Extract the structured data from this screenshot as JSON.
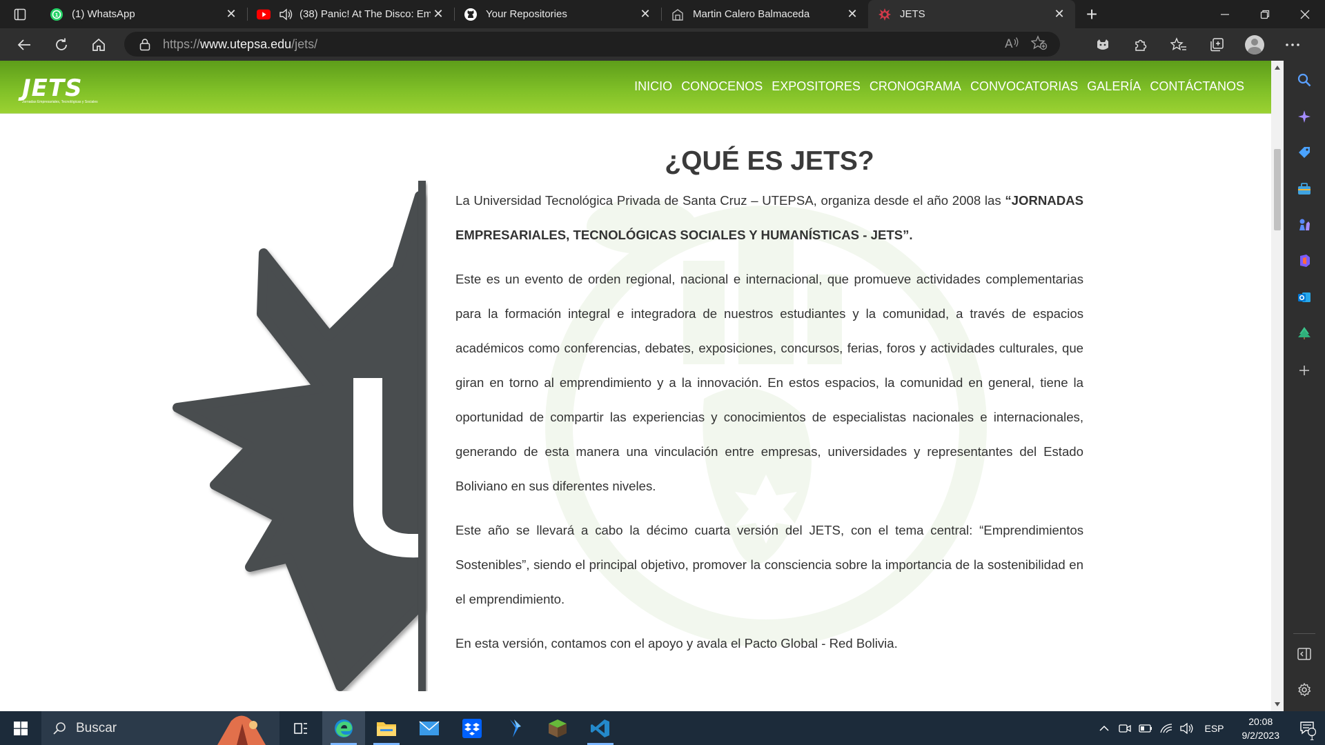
{
  "browser": {
    "tabs": [
      {
        "title": "(1) WhatsApp",
        "icon": "whatsapp-icon",
        "active": false
      },
      {
        "title": "(38) Panic! At The Disco: Em",
        "icon": "youtube-icon",
        "audible": true,
        "active": false
      },
      {
        "title": "Your Repositories",
        "icon": "github-icon",
        "active": false
      },
      {
        "title": "Martin Calero Balmaceda",
        "icon": "page-icon",
        "active": false
      },
      {
        "title": "JETS",
        "icon": "jets-icon",
        "active": true
      }
    ],
    "url": {
      "scheme": "https://",
      "host": "www.utepsa.edu",
      "path": "/jets/"
    }
  },
  "site": {
    "logo": {
      "text": "JETS",
      "subtitle": "Jornadas Empresariales, Tecnológicas y Sociales"
    },
    "nav": [
      "INICIO",
      "CONOCENOS",
      "EXPOSITORES",
      "CRONOGRAMA",
      "CONVOCATORIAS",
      "GALERÍA",
      "CONTÁCTANOS"
    ],
    "heading": "¿QUÉ ES JETS?",
    "intro": "La Universidad Tecnológica Privada de Santa Cruz – UTEPSA, organiza desde el año 2008 las",
    "intro_strong": "“JORNADAS EMPRESARIALES, TECNOLÓGICAS SOCIALES Y HUMANÍSTICAS - JETS”.",
    "paragraphs": [
      "Este es un evento de orden regional, nacional e internacional, que promueve actividades complementarias para la formación integral e integradora de nuestros estudiantes y la comunidad, a través de espacios académicos como conferencias, debates, exposiciones, concursos, ferias, foros y actividades culturales, que giran en torno al emprendimiento y a la innovación. En estos espacios, la comunidad en general, tiene la oportunidad de compartir las experiencias y conocimientos de especialistas nacionales e internacionales, generando de esta manera una vinculación entre empresas, universidades y representantes del Estado Boliviano en sus diferentes niveles.",
      "Este año se llevará a cabo la décimo cuarta versión del JETS, con el tema central: “Emprendimientos Sostenibles”, siendo el principal objetivo, promover la consciencia sobre la importancia de la sostenibilidad en el emprendimiento.",
      "En esta versión, contamos con el apoyo y avala el Pacto Global - Red Bolivia."
    ],
    "colors": {
      "header_green": "#7fbf27",
      "emblem_gray": "#4a4d50"
    }
  },
  "taskbar": {
    "search_placeholder": "Buscar",
    "lang": "ESP",
    "time": "20:08",
    "date": "9/2/2023",
    "notifications": "1"
  }
}
